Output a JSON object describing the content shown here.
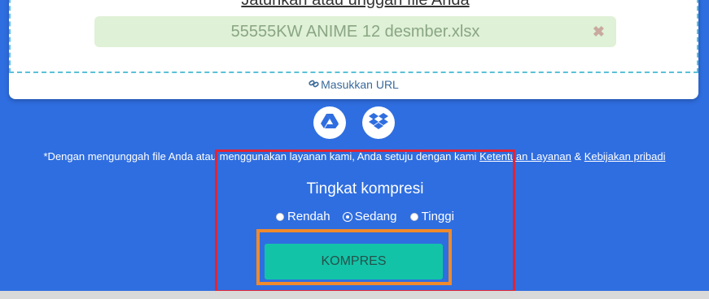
{
  "upload": {
    "drop_text": "Jatuhkan atau unggah file Anda",
    "file_name": "55555KW ANIME 12 desmber.xlsx",
    "remove_symbol": "✖",
    "url_label": "Masukkan URL"
  },
  "cloud": {
    "gdrive_icon": "google-drive-icon",
    "dropbox_icon": "dropbox-icon"
  },
  "terms": {
    "prefix": "*Dengan mengunggah file Anda atau menggunakan layanan kami, Anda setuju dengan kami ",
    "terms_link": "Ketentuan Layanan",
    "and": " & ",
    "privacy_link": "Kebijakan pribadi"
  },
  "compression": {
    "title": "Tingkat kompresi",
    "options": [
      "Rendah",
      "Sedang",
      "Tinggi"
    ],
    "selected": "Sedang",
    "button_label": "KOMPRES"
  },
  "colors": {
    "background": "#2f6ee0",
    "button": "#13c3a8",
    "highlight_red": "#e02437",
    "highlight_orange": "#f08a2c"
  }
}
